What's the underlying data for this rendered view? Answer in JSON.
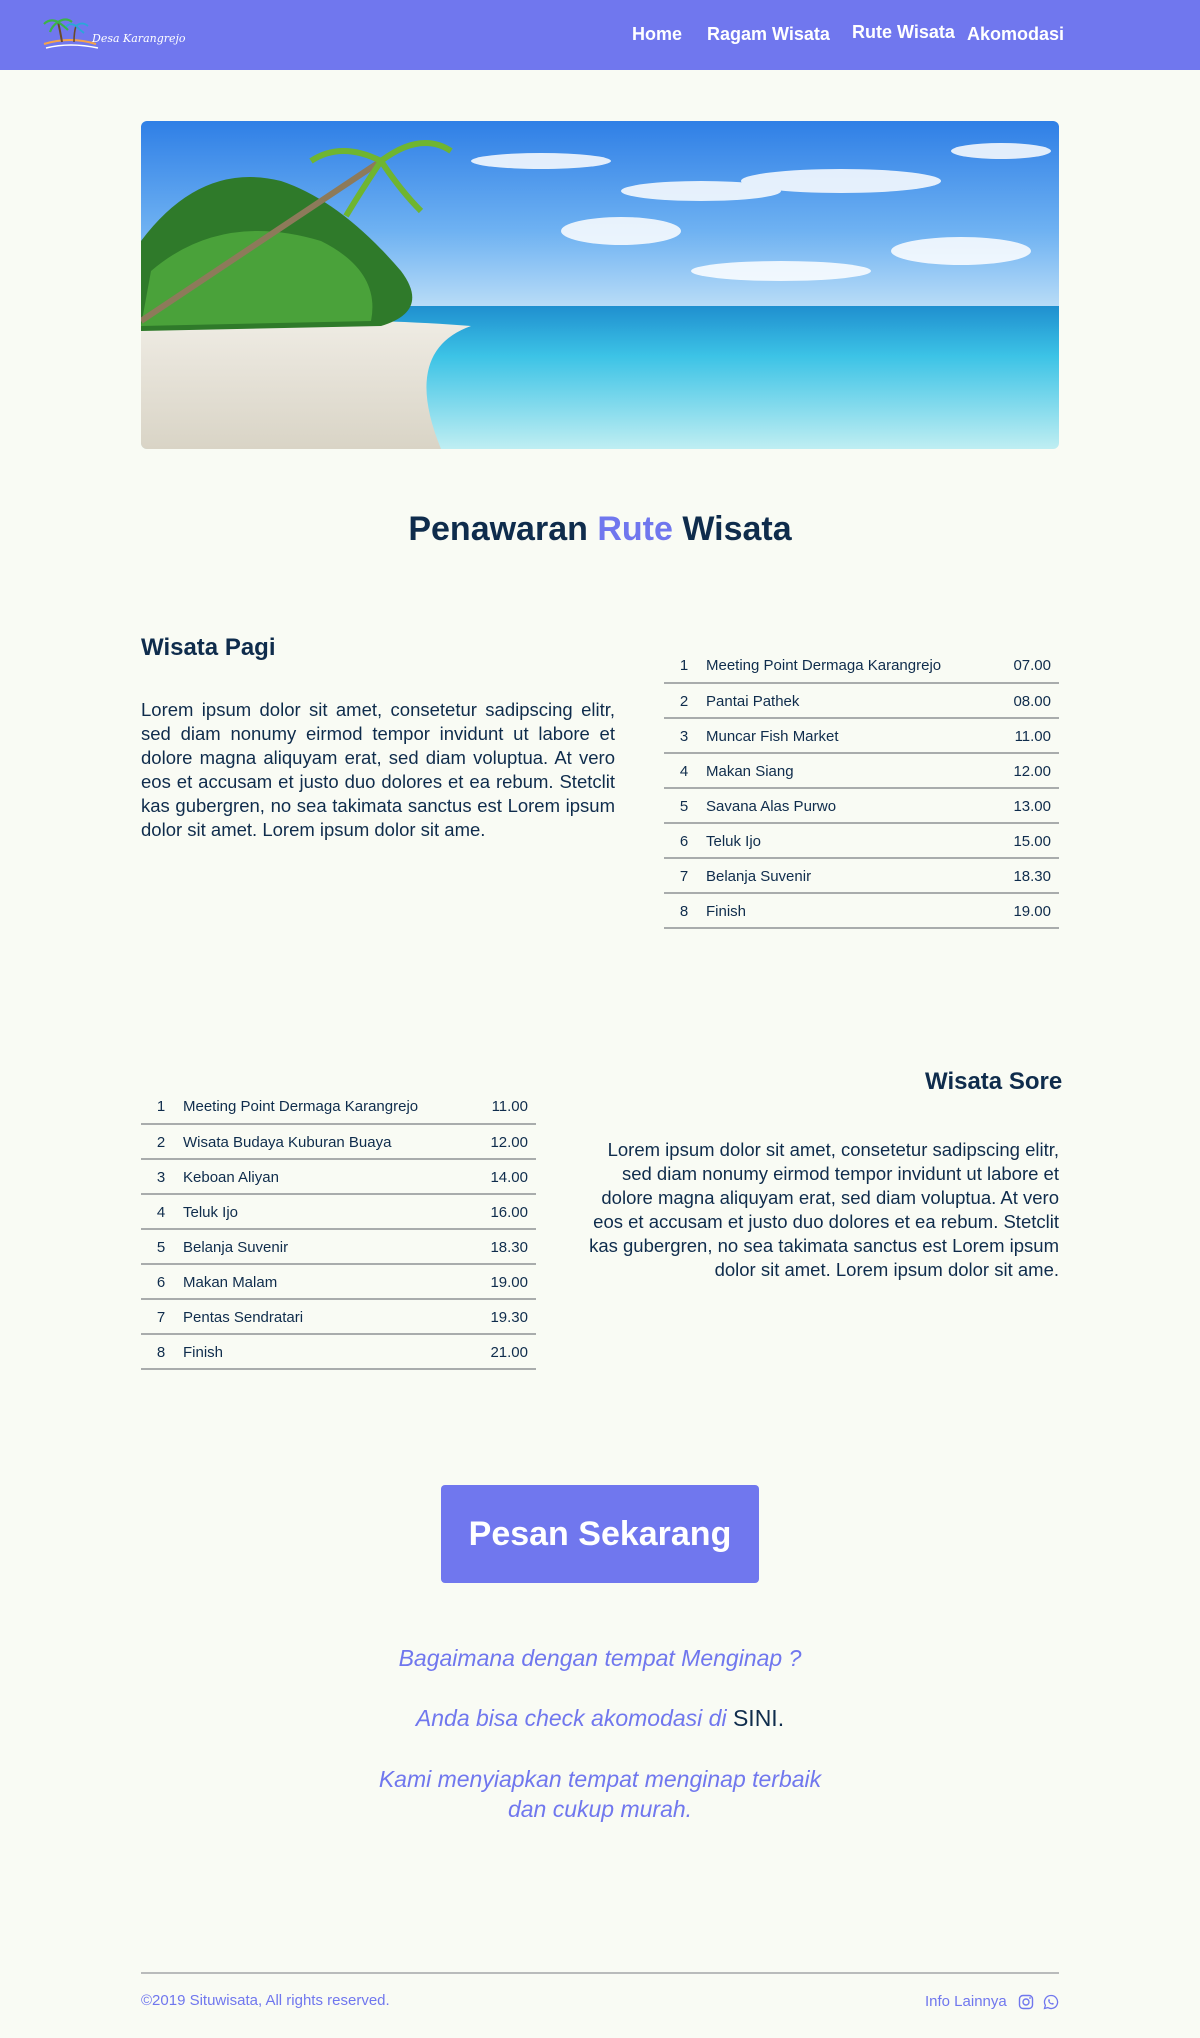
{
  "nav": {
    "logo_text": "Desa Karangrejo",
    "links": [
      "Home",
      "Ragam Wisata",
      "Rute Wisata",
      "Akomodasi"
    ]
  },
  "hero": {
    "image": "tropical-beach-photo"
  },
  "title": {
    "prefix": "Penawaran",
    "accent": "Rute",
    "suffix": "Wisata"
  },
  "pagi": {
    "heading": "Wisata Pagi",
    "text": "Lorem ipsum dolor sit amet, consetetur sadipscing elitr, sed diam nonumy eirmod tempor invidunt ut labore et dolore magna aliquyam erat, sed diam voluptua. At vero eos et accusam et justo duo dolores et ea rebum. Stetclit kas gubergren, no sea takimata sanctus est Lorem ipsum dolor sit amet. Lorem ipsum dolor sit ame.",
    "routes": [
      {
        "num": "1",
        "place": "Meeting Point Dermaga Karangrejo",
        "time": "07.00"
      },
      {
        "num": "2",
        "place": "Pantai Pathek",
        "time": "08.00"
      },
      {
        "num": "3",
        "place": "Muncar Fish Market",
        "time": "11.00"
      },
      {
        "num": "4",
        "place": "Makan Siang",
        "time": "12.00"
      },
      {
        "num": "5",
        "place": "Savana Alas Purwo",
        "time": "13.00"
      },
      {
        "num": "6",
        "place": "Teluk Ijo",
        "time": "15.00"
      },
      {
        "num": "7",
        "place": "Belanja Suvenir",
        "time": "18.30"
      },
      {
        "num": "8",
        "place": "Finish",
        "time": "19.00"
      }
    ]
  },
  "sore": {
    "heading": "Wisata Sore",
    "text": "Lorem ipsum dolor sit amet, consetetur sadipscing elitr, sed diam nonumy eirmod tempor invidunt ut labore et dolore magna aliquyam erat, sed diam voluptua. At vero eos et accusam et justo duo dolores et ea rebum. Stetclit kas gubergren, no sea takimata sanctus est Lorem ipsum dolor sit amet. Lorem ipsum dolor sit ame.",
    "routes": [
      {
        "num": "1",
        "place": "Meeting Point Dermaga Karangrejo",
        "time": "11.00"
      },
      {
        "num": "2",
        "place": "Wisata Budaya Kuburan Buaya",
        "time": "12.00"
      },
      {
        "num": "3",
        "place": "Keboan Aliyan",
        "time": "14.00"
      },
      {
        "num": "4",
        "place": "Teluk Ijo",
        "time": "16.00"
      },
      {
        "num": "5",
        "place": "Belanja Suvenir",
        "time": "18.30"
      },
      {
        "num": "6",
        "place": "Makan Malam",
        "time": "19.00"
      },
      {
        "num": "7",
        "place": "Pentas Sendratari",
        "time": "19.30"
      },
      {
        "num": "8",
        "place": "Finish",
        "time": "21.00"
      }
    ]
  },
  "cta": {
    "label": "Pesan Sekarang"
  },
  "info": {
    "line1": "Bagaimana dengan tempat Menginap ?",
    "line2_prefix": "Anda bisa check akomodasi di",
    "line2_link": "SINI",
    "line2_suffix": ".",
    "line3_a": "Kami menyiapkan tempat menginap terbaik",
    "line3_b": "dan cukup murah."
  },
  "footer": {
    "copyright": "©2019 Situwisata, All rights reserved.",
    "info_label": "Info Lainnya",
    "icons": [
      "instagram-icon",
      "whatsapp-icon"
    ]
  },
  "colors": {
    "accent": "#7077ee",
    "text": "#0f2c4c",
    "background": "#f9fbf4"
  }
}
